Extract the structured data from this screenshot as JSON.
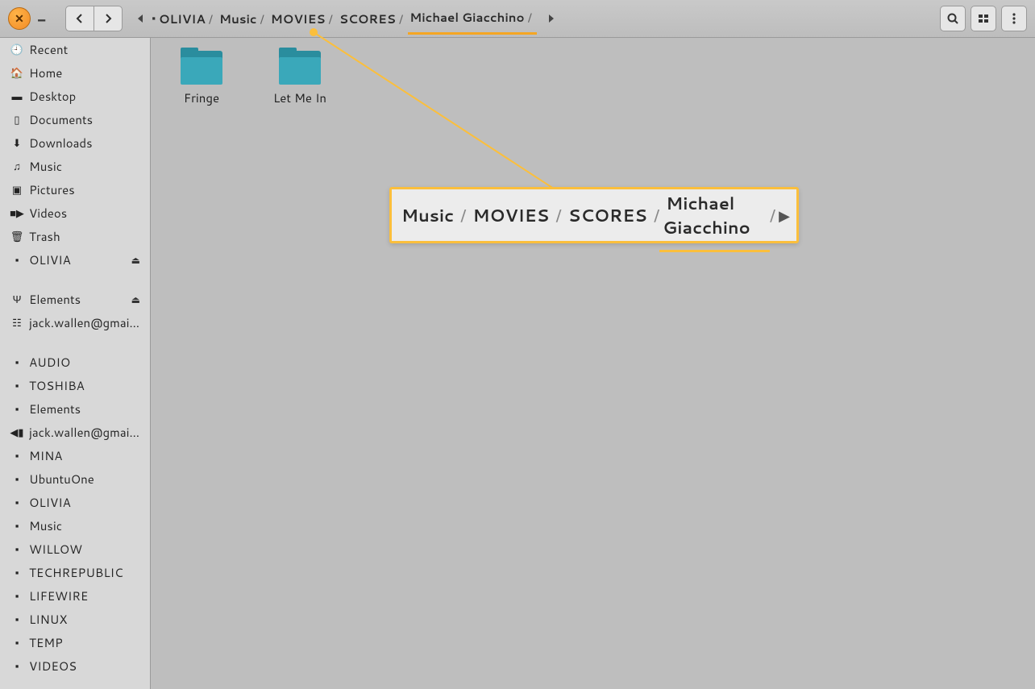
{
  "header": {
    "breadcrumb": [
      {
        "label": "OLIVIA",
        "icon": "hdd"
      },
      {
        "label": "Music"
      },
      {
        "label": "MOVIES"
      },
      {
        "label": "SCORES"
      },
      {
        "label": "Michael Giacchino",
        "active": true
      }
    ]
  },
  "sidebar_groups": [
    [
      {
        "icon": "clock",
        "label": "Recent"
      },
      {
        "icon": "home",
        "label": "Home"
      },
      {
        "icon": "desktop",
        "label": "Desktop"
      },
      {
        "icon": "doc",
        "label": "Documents"
      },
      {
        "icon": "download",
        "label": "Downloads"
      },
      {
        "icon": "music",
        "label": "Music"
      },
      {
        "icon": "picture",
        "label": "Pictures"
      },
      {
        "icon": "video",
        "label": "Videos"
      },
      {
        "icon": "trash",
        "label": "Trash"
      },
      {
        "icon": "hdd",
        "label": "OLIVIA",
        "eject": true
      }
    ],
    [
      {
        "icon": "usb",
        "label": "Elements",
        "eject": true
      },
      {
        "icon": "net",
        "label": "jack.wallen@gmail.com"
      }
    ],
    [
      {
        "icon": "folder",
        "label": "AUDIO"
      },
      {
        "icon": "folder",
        "label": "TOSHIBA"
      },
      {
        "icon": "folder",
        "label": "Elements"
      },
      {
        "icon": "sound",
        "label": "jack.wallen@gmail.com"
      },
      {
        "icon": "folder",
        "label": "MINA"
      },
      {
        "icon": "folder",
        "label": "UbuntuOne"
      },
      {
        "icon": "folder",
        "label": "OLIVIA"
      },
      {
        "icon": "folder",
        "label": "Music"
      },
      {
        "icon": "folder",
        "label": "WILLOW"
      },
      {
        "icon": "folder",
        "label": "TECHREPUBLIC"
      },
      {
        "icon": "folder",
        "label": "LIFEWIRE"
      },
      {
        "icon": "folder",
        "label": "LINUX"
      },
      {
        "icon": "folder",
        "label": "TEMP"
      },
      {
        "icon": "folder",
        "label": "VIDEOS"
      }
    ]
  ],
  "folders": [
    {
      "name": "Fringe"
    },
    {
      "name": "Let Me In"
    }
  ],
  "callout": {
    "items": [
      "Music",
      "MOVIES",
      "SCORES",
      "Michael Giacchino"
    ],
    "active_index": 3
  }
}
